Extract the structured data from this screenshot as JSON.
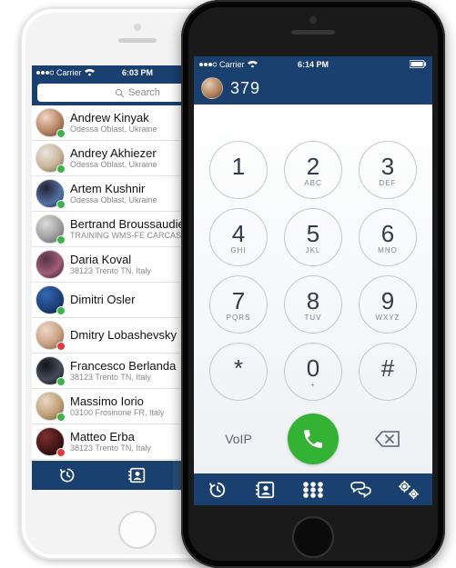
{
  "phone1": {
    "status": {
      "carrier": "Carrier",
      "time": "6:03 PM"
    },
    "search": {
      "placeholder": "Search"
    },
    "contacts": [
      {
        "name": "Andrew Kinyak",
        "detail": "Odessa Oblast, Ukraine",
        "avatar": "a1",
        "presence": "online"
      },
      {
        "name": "Andrey Akhiezer",
        "detail": "Odessa Oblast, Ukraine",
        "avatar": "a2",
        "presence": "online"
      },
      {
        "name": "Artem Kushnir",
        "detail": "Odessa Oblast, Ukraine",
        "avatar": "a3",
        "presence": "online"
      },
      {
        "name": "Bertrand Broussaudier",
        "detail": "TRAINING WMS-FE CARCASSONNE",
        "avatar": "a4",
        "presence": "online"
      },
      {
        "name": "Daria Koval",
        "detail": "38123 Trento TN, Italy",
        "avatar": "a5",
        "presence": ""
      },
      {
        "name": "Dimitri Osler",
        "detail": "",
        "avatar": "a6",
        "presence": "online"
      },
      {
        "name": "Dmitry Lobashevsky",
        "detail": "",
        "avatar": "a7",
        "presence": "busy"
      },
      {
        "name": "Francesco Berlanda",
        "detail": "38123 Trento TN, Italy",
        "avatar": "a8",
        "presence": "online"
      },
      {
        "name": "Massimo Iorio",
        "detail": "03100 Frosinone FR, Italy",
        "avatar": "a9",
        "presence": "online"
      },
      {
        "name": "Matteo Erba",
        "detail": "38123 Trento TN, Italy",
        "avatar": "a10",
        "presence": "busy"
      }
    ],
    "tabs": {
      "history": "history-icon",
      "contacts": "contacts-icon",
      "dialpad": "dialpad-icon"
    }
  },
  "phone2": {
    "status": {
      "carrier": "Carrier",
      "time": "6:14 PM"
    },
    "dialed_number": "379",
    "keys": [
      {
        "digit": "1",
        "letters": ""
      },
      {
        "digit": "2",
        "letters": "ABC"
      },
      {
        "digit": "3",
        "letters": "DEF"
      },
      {
        "digit": "4",
        "letters": "GHI"
      },
      {
        "digit": "5",
        "letters": "JKL"
      },
      {
        "digit": "6",
        "letters": "MNO"
      },
      {
        "digit": "7",
        "letters": "PQRS"
      },
      {
        "digit": "8",
        "letters": "TUV"
      },
      {
        "digit": "9",
        "letters": "WXYZ"
      },
      {
        "digit": "*",
        "letters": ""
      },
      {
        "digit": "0",
        "letters": "+"
      },
      {
        "digit": "#",
        "letters": ""
      }
    ],
    "voip_label": "VoIP",
    "tabs": {
      "history": "history-icon",
      "contacts": "contacts-icon",
      "dialpad": "dialpad-icon",
      "chat": "chat-icon",
      "settings": "settings-icon"
    }
  },
  "colors": {
    "brand": "#19406f",
    "accent_green": "#34b233",
    "online": "#3bb54a",
    "busy": "#e23b3b"
  }
}
